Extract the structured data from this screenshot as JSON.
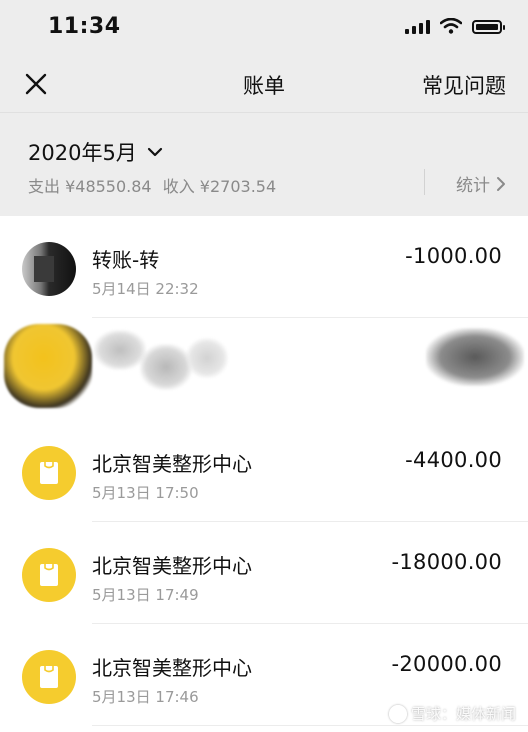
{
  "status_bar": {
    "time": "11:34"
  },
  "nav": {
    "title": "账单",
    "faq": "常见问题",
    "close_icon": "close-icon"
  },
  "month": {
    "label": "2020年5月",
    "expense": "支出 ¥48550.84",
    "income": "收入 ¥2703.54",
    "stats": "统计"
  },
  "transactions": [
    {
      "title": "转账-转",
      "time": "5月14日 22:32",
      "amount": "-1000.00",
      "icon": "avatar-photo"
    },
    {
      "title": "北京智美整形中心",
      "time": "5月13日 17:50",
      "amount": "-4400.00",
      "icon": "shopping-bag-icon"
    },
    {
      "title": "北京智美整形中心",
      "time": "5月13日 17:49",
      "amount": "-18000.00",
      "icon": "shopping-bag-icon"
    },
    {
      "title": "北京智美整形中心",
      "time": "5月13日 17:46",
      "amount": "-20000.00",
      "icon": "shopping-bag-icon"
    }
  ],
  "watermark": "雪球：媒体新闻",
  "colors": {
    "header_bg": "#ededed",
    "merchant_yellow": "#f5cc2e",
    "text_secondary": "#8a8a8a"
  }
}
